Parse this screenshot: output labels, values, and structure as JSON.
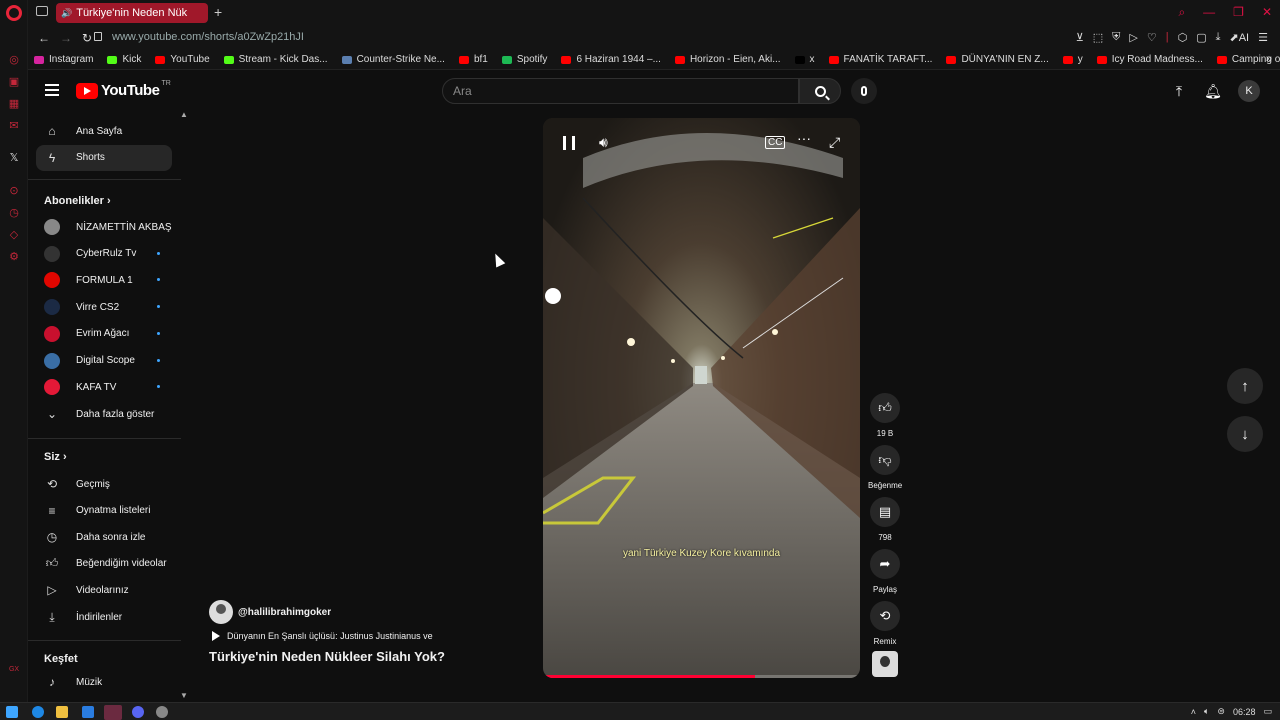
{
  "browser": {
    "tab_title": "Türkiye'nin Neden Nük",
    "new_tab_label": "+",
    "url": "www.youtube.com/shorts/a0ZwZp21hJI",
    "ai_label": "AI",
    "bookmarks": [
      {
        "label": "Instagram",
        "color": "#d6249f"
      },
      {
        "label": "Kick",
        "color": "#53fc18"
      },
      {
        "label": "YouTube",
        "color": "#ff0000"
      },
      {
        "label": "Stream - Kick Das...",
        "color": "#53fc18"
      },
      {
        "label": "Counter-Strike Ne...",
        "color": "#5b7fb0"
      },
      {
        "label": "bf1",
        "color": "#ff0000"
      },
      {
        "label": "Spotify",
        "color": "#1db954"
      },
      {
        "label": "6 Haziran 1944 –...",
        "color": "#ff0000"
      },
      {
        "label": "Horizon - Eien, Aki...",
        "color": "#ff0000"
      },
      {
        "label": "x",
        "color": "#000000"
      },
      {
        "label": "FANATİK TARAFT...",
        "color": "#ff0000"
      },
      {
        "label": "DÜNYA'NIN EN Z...",
        "color": "#ff0000"
      },
      {
        "label": "y",
        "color": "#ff0000"
      },
      {
        "label": "Icy Road Madness...",
        "color": "#ff0000"
      },
      {
        "label": "Camping on Froze...",
        "color": "#ff0000"
      }
    ]
  },
  "youtube": {
    "logo_text": "YouTube",
    "logo_region": "TR",
    "search_placeholder": "Ara",
    "avatar_letter": "K",
    "sidebar": {
      "main": [
        {
          "label": "Ana Sayfa",
          "icon": "home-icon"
        },
        {
          "label": "Shorts",
          "icon": "shorts-icon",
          "active": true
        }
      ],
      "subscriptions_heading": "Abonelikler",
      "subscriptions": [
        {
          "label": "NİZAMETTİN AKBAŞ",
          "color": "#888888",
          "dot": false
        },
        {
          "label": "CyberRulz Tv",
          "color": "#333333",
          "dot": true
        },
        {
          "label": "FORMULA 1",
          "color": "#e10600",
          "dot": true
        },
        {
          "label": "Virre CS2",
          "color": "#1b2a44",
          "dot": true
        },
        {
          "label": "Evrim Ağacı",
          "color": "#c8102e",
          "dot": true
        },
        {
          "label": "Digital Scope",
          "color": "#3a6ea5",
          "dot": true
        },
        {
          "label": "KAFA TV",
          "color": "#e31937",
          "dot": true
        }
      ],
      "show_more": "Daha fazla göster",
      "you_heading": "Siz",
      "you": [
        {
          "label": "Geçmiş",
          "icon": "history-icon"
        },
        {
          "label": "Oynatma listeleri",
          "icon": "playlists-icon"
        },
        {
          "label": "Daha sonra izle",
          "icon": "watch-later-icon"
        },
        {
          "label": "Beğendiğim videolar",
          "icon": "liked-icon"
        },
        {
          "label": "Videolarınız",
          "icon": "your-videos-icon"
        },
        {
          "label": "İndirilenler",
          "icon": "downloads-icon"
        }
      ],
      "explore_heading": "Keşfet",
      "explore": [
        {
          "label": "Müzik",
          "icon": "music-icon"
        }
      ]
    },
    "short": {
      "channel": "@halilibrahimgoker",
      "playlist": "Dünyanın En Şanslı üçlüsü: Justinus Justinianus ve",
      "title": "Türkiye'nin Neden Nükleer Silahı Yok?",
      "subtitle": "yani Türkiye Kuzey Kore kıvamında",
      "progress": 0.67,
      "likes": "19 B",
      "dislike_label": "Beğenme",
      "comments": "798",
      "share_label": "Paylaş",
      "remix_label": "Remix"
    }
  },
  "taskbar": {
    "time": "06:28"
  }
}
